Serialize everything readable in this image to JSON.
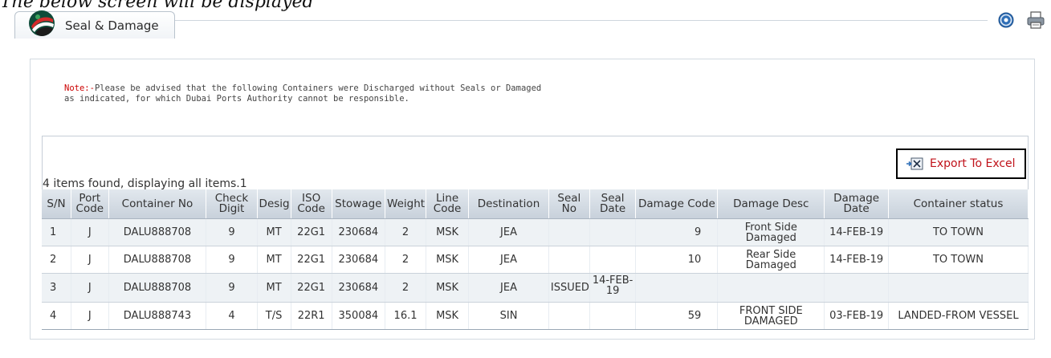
{
  "caption": "The below screen will be displayed",
  "tab": {
    "label": "Seal & Damage"
  },
  "note": {
    "label": "Note:-",
    "line1": "Please be advised that the following Containers were Discharged without Seals or Damaged",
    "line2": "as indicated, for which Dubai Ports Authority cannot be responsible."
  },
  "export_label": "Export To Excel",
  "items_found": "4 items found, displaying all items.1",
  "columns": [
    "S/N",
    "Port Code",
    "Container No",
    "Check Digit",
    "Desig",
    "ISO Code",
    "Stowage",
    "Weight",
    "Line Code",
    "Destination",
    "Seal No",
    "Seal Date",
    "Damage Code",
    "Damage Desc",
    "Damage Date",
    "Container status"
  ],
  "rows": [
    [
      "1",
      "J",
      "DALU888708",
      "9",
      "MT",
      "22G1",
      "230684",
      "2",
      "MSK",
      "JEA",
      "",
      "",
      "9",
      "Front Side Damaged",
      "14-FEB-19",
      "TO TOWN"
    ],
    [
      "2",
      "J",
      "DALU888708",
      "9",
      "MT",
      "22G1",
      "230684",
      "2",
      "MSK",
      "JEA",
      "",
      "",
      "10",
      "Rear Side Damaged",
      "14-FEB-19",
      "TO TOWN"
    ],
    [
      "3",
      "J",
      "DALU888708",
      "9",
      "MT",
      "22G1",
      "230684",
      "2",
      "MSK",
      "JEA",
      "ISSUED",
      "14-FEB-19",
      "",
      "",
      "",
      ""
    ],
    [
      "4",
      "J",
      "DALU888743",
      "4",
      "T/S",
      "22R1",
      "350084",
      "16.1",
      "MSK",
      "SIN",
      "",
      "",
      "59",
      "FRONT SIDE DAMAGED",
      "03-FEB-19",
      "LANDED-FROM VESSEL"
    ]
  ],
  "icons": {
    "help": "help-icon",
    "print": "print-icon",
    "excel": "excel-icon",
    "logo": "logo-icon"
  },
  "colors": {
    "note_label": "#cc0000",
    "export_label": "#c0121a",
    "header_bg": "#d3dbe3"
  }
}
